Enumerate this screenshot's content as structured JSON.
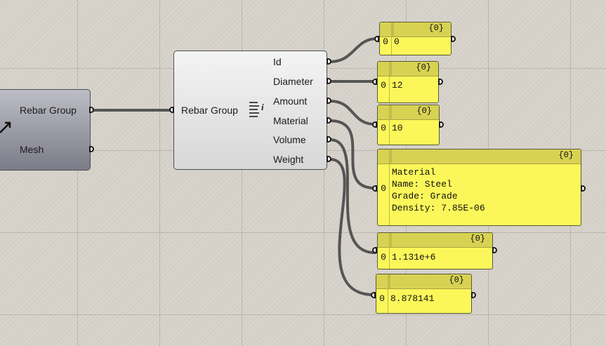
{
  "source_component": {
    "outputs": [
      "Rebar Group",
      "Mesh"
    ]
  },
  "rebar_group_component": {
    "input_label": "Rebar Group",
    "outputs": [
      "Id",
      "Diameter",
      "Amount",
      "Material",
      "Volume",
      "Weight"
    ]
  },
  "panels": [
    {
      "title": "{0}",
      "index": "0",
      "value": "0"
    },
    {
      "title": "{0}",
      "index": "0",
      "value": "12"
    },
    {
      "title": "{0}",
      "index": "0",
      "value": "10"
    },
    {
      "title": "{0}",
      "index": "0",
      "value": "Material\nName: Steel\nGrade: Grade\nDensity: 7.85E-06"
    },
    {
      "title": "{0}",
      "index": "0",
      "value": "1.131e+6"
    },
    {
      "title": "{0}",
      "index": "0",
      "value": "8.878141"
    }
  ],
  "colors": {
    "canvas": "#d4d0c8",
    "wire": "#555555",
    "panel_fill": "#fbf75a",
    "panel_header": "#d8d253"
  },
  "icons": [
    "arrow-icon",
    "info-list-icon"
  ]
}
